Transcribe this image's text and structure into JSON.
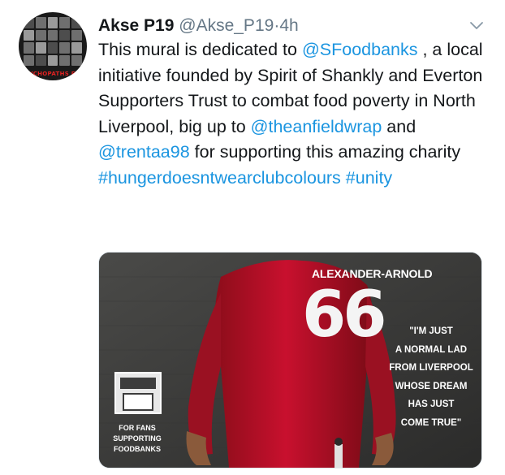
{
  "avatar": {
    "caption": "PSYCHOPATHS PRO"
  },
  "header": {
    "display_name": "Akse P19",
    "handle": "@Akse_P19",
    "separator": "·",
    "time": "4h"
  },
  "tweet": {
    "t1": "This mural is dedicated to ",
    "m1": "@SFoodbanks",
    "t2": " , a local initiative founded by Spirit of Shankly and Everton Supporters Trust to combat food poverty in North Liverpool, big up to ",
    "m2": "@theanfieldwrap",
    "t3": " and ",
    "m3": "@trentaa98",
    "t4": " for supporting this amazing charity ",
    "h1": "#hungerdoesntwearclubcolours",
    "t5": " ",
    "h2": "#unity"
  },
  "mural": {
    "name": "ALEXANDER-ARNOLD",
    "number": "66",
    "quote": [
      "\"I'M JUST",
      "A NORMAL LAD",
      "FROM LIVERPOOL",
      "WHOSE DREAM",
      "HAS JUST",
      "COME TRUE\""
    ],
    "fans": [
      "FOR FANS",
      "SUPPORTING",
      "FOODBANKS"
    ]
  },
  "colors": {
    "link": "#1b95e0",
    "meta": "#657786",
    "text": "#14171a",
    "shirt": "#c8102e"
  },
  "icons": [
    "chevron-down-icon",
    "foodbank-logo-icon"
  ]
}
